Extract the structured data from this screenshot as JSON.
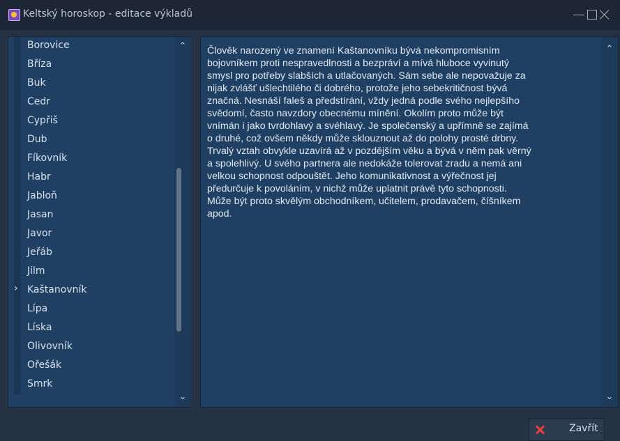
{
  "window": {
    "title": "Keltský horoskop - editace výkladů",
    "icon": "app-icon"
  },
  "list": {
    "items": [
      {
        "label": "Borovice"
      },
      {
        "label": "Bříza"
      },
      {
        "label": "Buk"
      },
      {
        "label": "Cedr"
      },
      {
        "label": "Cypřiš"
      },
      {
        "label": "Dub"
      },
      {
        "label": "Fíkovník"
      },
      {
        "label": "Habr"
      },
      {
        "label": "Jabloň"
      },
      {
        "label": "Jasan"
      },
      {
        "label": "Javor"
      },
      {
        "label": "Jeřáb"
      },
      {
        "label": "Jilm"
      },
      {
        "label": "Kaštanovník"
      },
      {
        "label": "Lípa"
      },
      {
        "label": "Líska"
      },
      {
        "label": "Olivovník"
      },
      {
        "label": "Ořešák"
      },
      {
        "label": "Smrk"
      }
    ],
    "selected_marker": "›",
    "scroll_up_icon": "chevron-up",
    "scroll_down_icon": "chevron-down"
  },
  "description": {
    "text": "Člověk narozený ve znamení Kaštanovníku bývá nekompromisním\nbojovníkem proti nespravedlnosti a bezpráví a mívá hluboce vyvinutý\nsmysl pro potřeby slabších a utlačovaných. Sám sebe ale nepovažuje za\nnijak zvlášť ušlechtilého či dobrého, protože jeho sebekritičnost bývá\nznačná. Nesnáší faleš a předstírání, vždy jedná podle svého nejlepšího\nsvědomí, často navzdory obecnému mínění. Okolím proto může být\nvnímán i jako tvrdohlavý a svéhlavý. Je společenský a upřímně se zajímá\no druhé, což ovšem někdy může sklouznout až do polohy prosté drbny.\nTrvalý vztah obvykle uzavírá až v pozdějším věku a bývá v něm pak věrný\na spolehlivý. U svého partnera ale nedokáže tolerovat zradu a nemá ani\nvelkou schopnost odpouštět. Jeho komunikativnost a výřečnost jej\npředurčuje k povoláním, v nichž může uplatnit právě tyto schopnosti.\nMůže být proto skvělým obchodníkem, učitelem, prodavačem, číšníkem\napod."
  },
  "buttons": {
    "close_label": "Zavřít"
  }
}
